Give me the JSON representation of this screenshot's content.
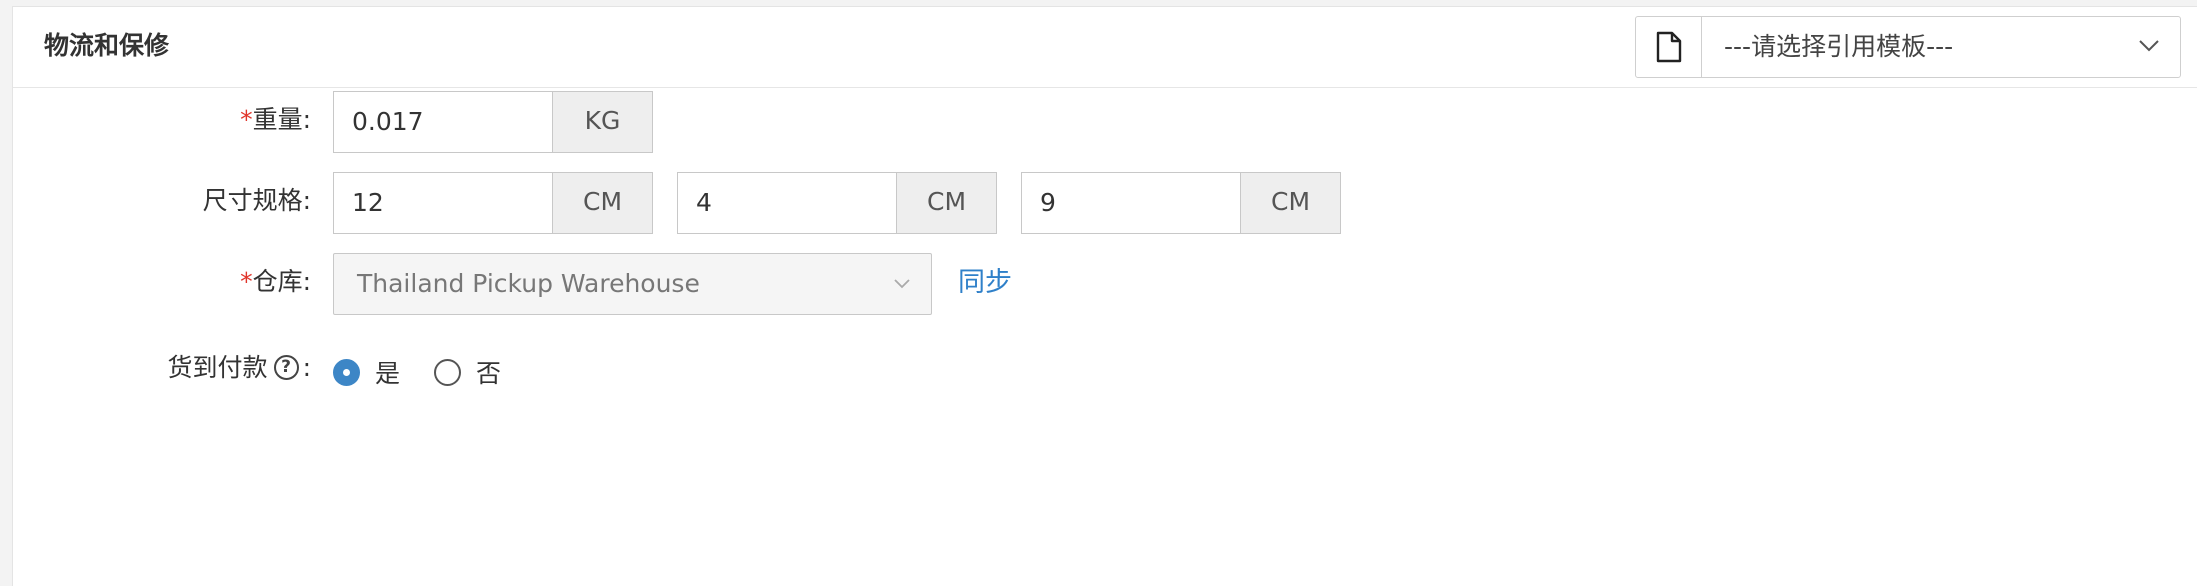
{
  "header": {
    "title": "物流和保修",
    "template_select": {
      "icon": "document-icon",
      "value": "---请选择引用模板---"
    }
  },
  "weight": {
    "required_mark": "*",
    "label": "重量:",
    "value": "0.017",
    "unit": "KG"
  },
  "dimensions": {
    "label": "尺寸规格:",
    "length": {
      "value": "12",
      "unit": "CM"
    },
    "width": {
      "value": "4",
      "unit": "CM"
    },
    "height": {
      "value": "9",
      "unit": "CM"
    }
  },
  "warehouse": {
    "required_mark": "*",
    "label": "仓库:",
    "value": "Thailand Pickup Warehouse",
    "sync_link": "同步"
  },
  "cod": {
    "label": "货到付款",
    "help_icon": "question-circle-icon",
    "help_glyph": "?",
    "colon": ":",
    "options": [
      {
        "label": "是",
        "checked": true
      },
      {
        "label": "否",
        "checked": false
      }
    ]
  },
  "colors": {
    "accent": "#3d86c6",
    "required": "#e0342a",
    "link": "#2f80c9"
  }
}
